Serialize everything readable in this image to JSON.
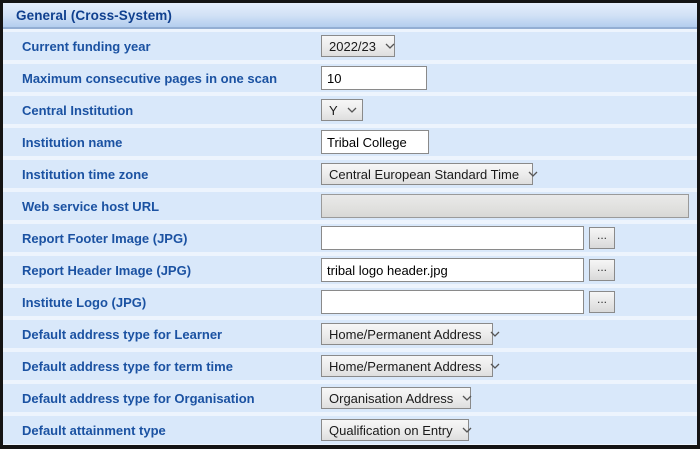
{
  "window": {
    "title": "General (Cross-System)"
  },
  "colors": {
    "header_text": "#10408f",
    "label_text": "#1b52a2",
    "row_background": "#d9e8fa",
    "header_gradient_top": "#e4eefb",
    "header_gradient_bottom": "#b3cdee"
  },
  "icons": {
    "chevron_down": "chevron-down-icon",
    "browse_label": "..."
  },
  "rows": [
    {
      "label": "Current funding year",
      "type": "select",
      "value": "2022/23"
    },
    {
      "label": "Maximum consecutive pages in one scan",
      "type": "text",
      "value": "10"
    },
    {
      "label": "Central Institution",
      "type": "select",
      "value": "Y"
    },
    {
      "label": "Institution name",
      "type": "text",
      "value": "Tribal College"
    },
    {
      "label": "Institution time zone",
      "type": "select",
      "value": "Central European Standard Time"
    },
    {
      "label": "Web service host URL",
      "type": "disabled-text",
      "value": ""
    },
    {
      "label": "Report Footer Image (JPG)",
      "type": "file",
      "value": "",
      "browse_label": "..."
    },
    {
      "label": "Report Header Image (JPG)",
      "type": "file",
      "value": "tribal logo header.jpg",
      "browse_label": "..."
    },
    {
      "label": "Institute Logo (JPG)",
      "type": "file",
      "value": "",
      "browse_label": "..."
    },
    {
      "label": "Default address type for Learner",
      "type": "select",
      "value": "Home/Permanent Address"
    },
    {
      "label": "Default address type for term time",
      "type": "select",
      "value": "Home/Permanent Address"
    },
    {
      "label": "Default address type for Organisation",
      "type": "select",
      "value": "Organisation Address"
    },
    {
      "label": "Default attainment type",
      "type": "select",
      "value": "Qualification on Entry"
    }
  ]
}
